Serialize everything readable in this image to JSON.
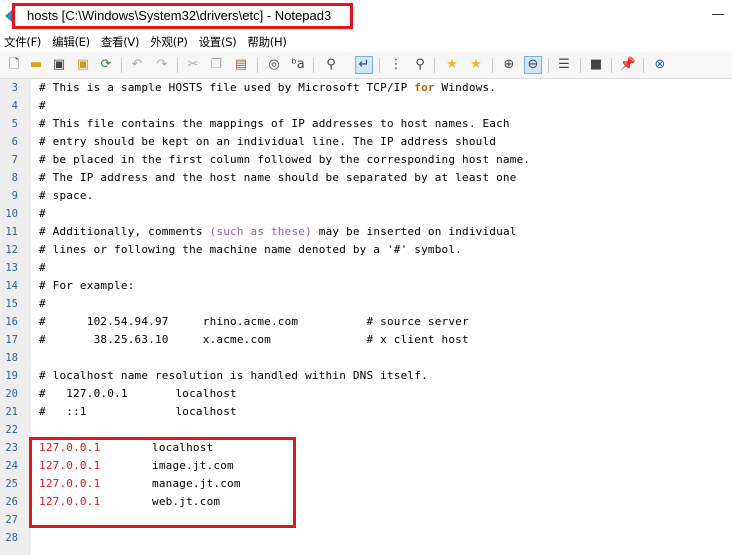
{
  "window": {
    "title": "hosts [C:\\Windows\\System32\\drivers\\etc] - Notepad3",
    "accent": "#e0161a"
  },
  "menu": [
    "文件(F)",
    "编辑(E)",
    "查看(V)",
    "外观(P)",
    "设置(S)",
    "帮助(H)"
  ],
  "toolbar": {
    "icons": [
      "new-file-icon",
      "open-folder-icon",
      "save-icon",
      "save-as-icon",
      "reload-icon",
      "undo-icon",
      "redo-icon",
      "cut-icon",
      "copy-icon",
      "paste-icon",
      "find-icon",
      "replace-icon",
      "zoom-icon",
      "word-wrap-icon",
      "line-numbers-icon",
      "find-in-files-icon",
      "bookmark-star-icon",
      "add-star-icon",
      "zoom-in-icon",
      "zoom-out-icon",
      "properties-icon",
      "terminal-icon",
      "pin-icon",
      "close-file-icon"
    ]
  },
  "editor": {
    "lines": [
      {
        "num": "3",
        "text": "# This is a sample HOSTS file used by Microsoft TCP/IP for Windows."
      },
      {
        "num": "4",
        "text": "#"
      },
      {
        "num": "5",
        "text": "# This file contains the mappings of IP addresses to host names. Each"
      },
      {
        "num": "6",
        "text": "# entry should be kept on an individual line. The IP address should"
      },
      {
        "num": "7",
        "text": "# be placed in the first column followed by the corresponding host name."
      },
      {
        "num": "8",
        "text": "# The IP address and the host name should be separated by at least one"
      },
      {
        "num": "9",
        "text": "# space."
      },
      {
        "num": "10",
        "text": "#"
      },
      {
        "num": "11",
        "text": "# Additionally, comments (such as these) may be inserted on individual"
      },
      {
        "num": "12",
        "text": "# lines or following the machine name denoted by a '#' symbol."
      },
      {
        "num": "13",
        "text": "#"
      },
      {
        "num": "14",
        "text": "# For example:"
      },
      {
        "num": "15",
        "text": "#"
      },
      {
        "num": "16",
        "text": "#      102.54.94.97     rhino.acme.com          # source server"
      },
      {
        "num": "17",
        "text": "#       38.25.63.10     x.acme.com              # x client host"
      },
      {
        "num": "18",
        "text": ""
      },
      {
        "num": "19",
        "text": "# localhost name resolution is handled within DNS itself."
      },
      {
        "num": "20",
        "text": "#   127.0.0.1       localhost"
      },
      {
        "num": "21",
        "text": "#   ::1             localhost"
      },
      {
        "num": "22",
        "text": ""
      },
      {
        "num": "23",
        "ip": "127.0.0.1",
        "host": "localhost"
      },
      {
        "num": "24",
        "ip": "127.0.0.1",
        "host": "image.jt.com"
      },
      {
        "num": "25",
        "ip": "127.0.0.1",
        "host": "manage.jt.com"
      },
      {
        "num": "26",
        "ip": "127.0.0.1",
        "host": "web.jt.com"
      },
      {
        "num": "27",
        "text": ""
      },
      {
        "num": "28",
        "text": ""
      }
    ]
  }
}
